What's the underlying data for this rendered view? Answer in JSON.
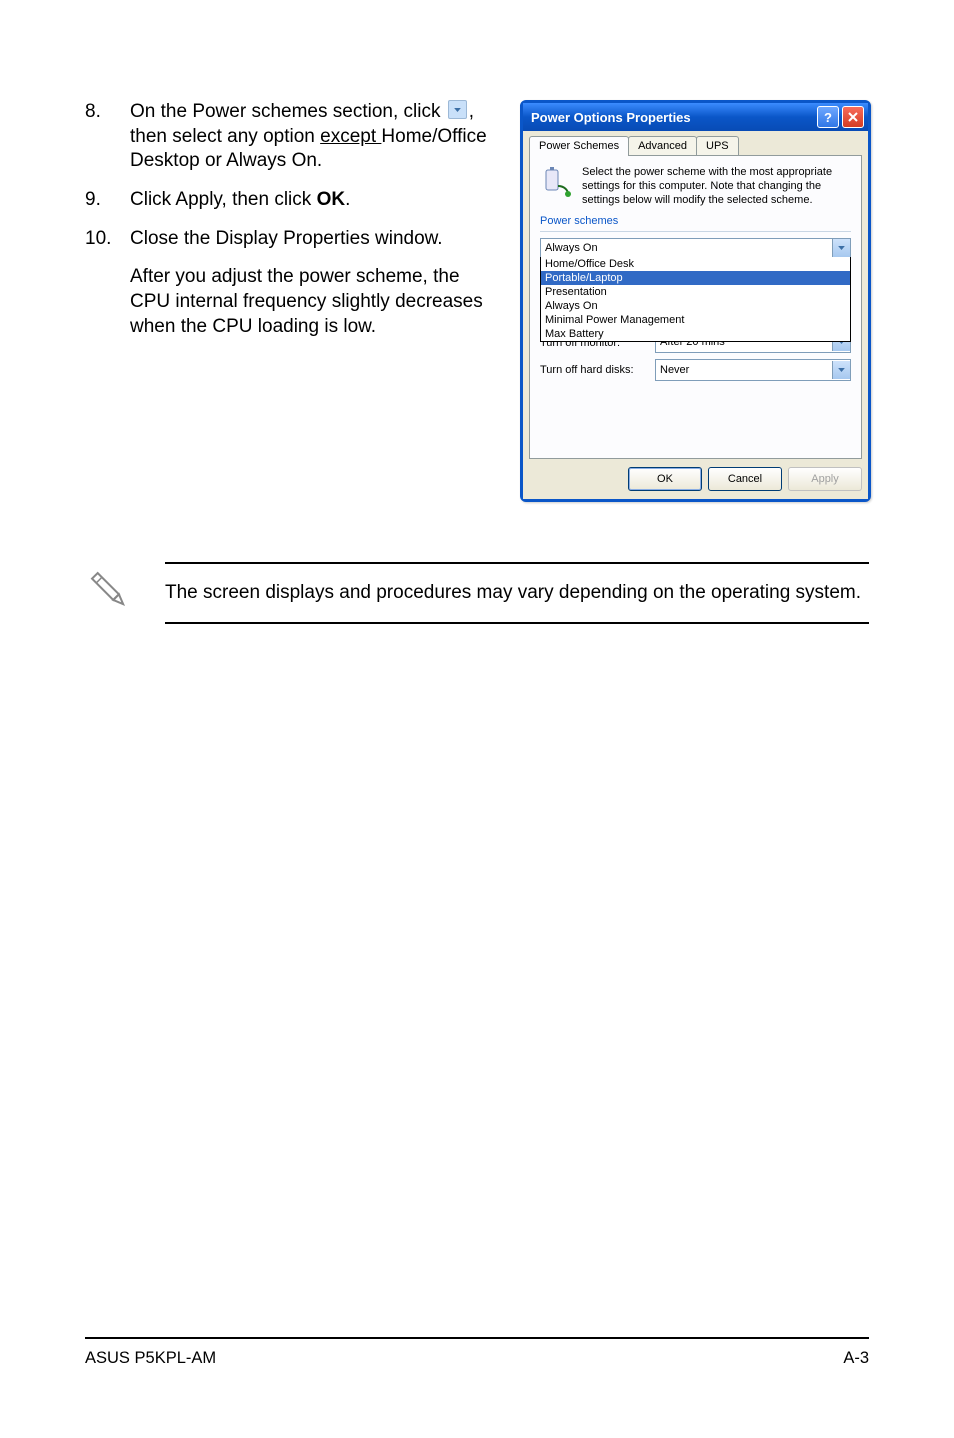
{
  "footer": {
    "left": "ASUS P5KPL-AM",
    "right": "A-3"
  },
  "instructions": {
    "item8_num": "8.",
    "item8_text_a": "On the Power schemes section, click",
    "item8_text_b": ", then select any option ",
    "item8_except": "except ",
    "item8_text_c": "Home/Office Desktop or Always On.",
    "item9_num": "9.",
    "item9_text_a": "Click Apply, then click ",
    "item9_ok": "OK",
    "item9_dot": ".",
    "item10_num": "10.",
    "item10_text": "Close the Display Properties window.",
    "continuation": "After you adjust the power scheme, the CPU internal frequency slightly decreases when the CPU loading is low."
  },
  "note": {
    "text": "The screen displays and procedures may vary depending on the operating system."
  },
  "xp": {
    "title": "Power Options Properties",
    "tabs": {
      "t1": "Power Schemes",
      "t2": "Advanced",
      "t3": "UPS"
    },
    "info": "Select the power scheme with the most appropriate settings for this computer. Note that changing the settings below will modify the selected scheme.",
    "section_label": "Power schemes",
    "combo_value": "Always On",
    "options": {
      "o1": "Home/Office Desk",
      "o2": "Portable/Laptop",
      "o3": "Presentation",
      "o4": "Always On",
      "o5": "Minimal Power Management",
      "o6": "Max Battery"
    },
    "row1": {
      "label": "Turn off monitor:",
      "value": "After 20 mins"
    },
    "row2": {
      "label": "Turn off hard disks:",
      "value": "Never"
    },
    "buttons": {
      "ok": "OK",
      "cancel": "Cancel",
      "apply": "Apply"
    }
  }
}
